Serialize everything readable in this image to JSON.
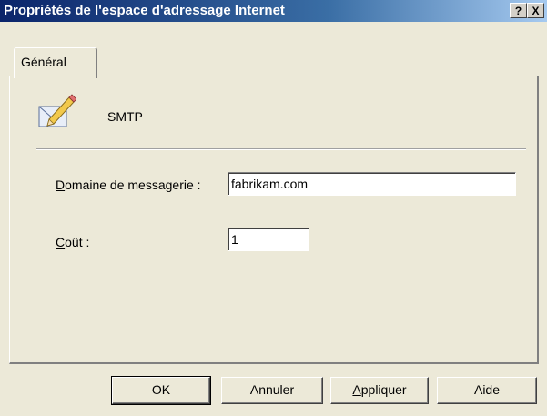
{
  "window": {
    "title": "Propriétés de l'espace d'adressage Internet",
    "help_glyph": "?",
    "close_glyph": "X"
  },
  "tabs": [
    {
      "label": "Général",
      "selected": true
    }
  ],
  "header": {
    "protocol": "SMTP",
    "icon": "envelope-pencil-icon"
  },
  "fields": {
    "domain": {
      "label_prefix": "",
      "label_accel": "D",
      "label_rest": "omaine de messagerie :",
      "value": "fabrikam.com"
    },
    "cost": {
      "label_prefix": "",
      "label_accel": "C",
      "label_rest": "oût :",
      "value": "1"
    }
  },
  "buttons": {
    "ok": "OK",
    "cancel": "Annuler",
    "apply_accel": "A",
    "apply_rest": "ppliquer",
    "help": "Aide"
  }
}
